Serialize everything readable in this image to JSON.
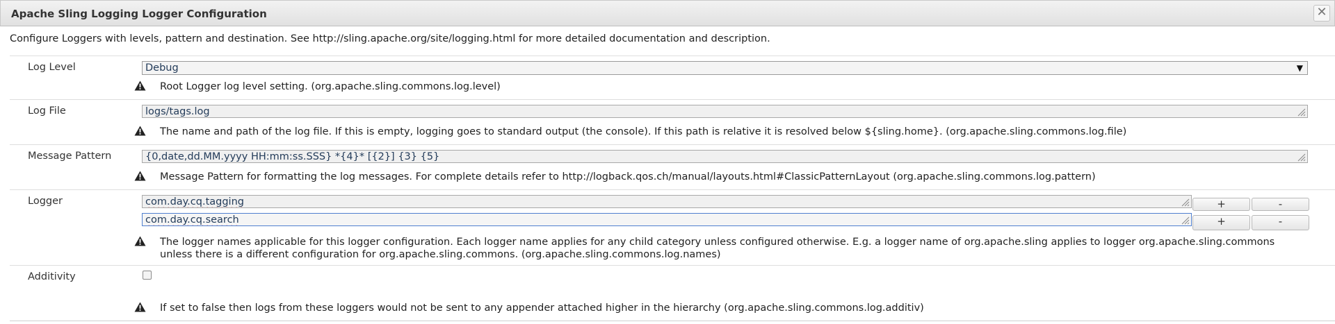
{
  "dialog": {
    "title": "Apache Sling Logging Logger Configuration",
    "close_icon": "close-icon",
    "description": "Configure Loggers with levels, pattern and destination. See http://sling.apache.org/site/logging.html for more detailed documentation and description."
  },
  "fields": {
    "log_level": {
      "label": "Log Level",
      "value": "Debug",
      "hint": "Root Logger log level setting. (org.apache.sling.commons.log.level)"
    },
    "log_file": {
      "label": "Log File",
      "value": "logs/tags.log",
      "hint": "The name and path of the log file. If this is empty, logging goes to standard output (the console). If this path is relative it is resolved below ${sling.home}. (org.apache.sling.commons.log.file)"
    },
    "message_pattern": {
      "label": "Message Pattern",
      "value": "{0,date,dd.MM.yyyy HH:mm:ss.SSS} *{4}* [{2}] {3} {5}",
      "hint": "Message Pattern for formatting the log messages. For complete details refer to http://logback.qos.ch/manual/layouts.html#ClassicPatternLayout (org.apache.sling.commons.log.pattern)"
    },
    "logger": {
      "label": "Logger",
      "values": [
        "com.day.cq.tagging",
        "com.day.cq.search"
      ],
      "add_label": "+",
      "remove_label": "-",
      "hint_line1": "The logger names applicable for this logger configuration. Each logger name applies for any child category unless configured otherwise. E.g. a logger name of org.apache.sling applies to logger org.apache.sling.commons",
      "hint_line2": "unless there is a different configuration for org.apache.sling.commons. (org.apache.sling.commons.log.names)"
    },
    "additivity": {
      "label": "Additivity",
      "checked": false,
      "hint": "If set to false then logs from these loggers would not be sent to any appender attached higher in the hierarchy (org.apache.sling.commons.log.additiv)"
    }
  },
  "icons": {
    "warning": "warning-icon",
    "resize": "resize-grip-icon",
    "dropdown": "chevron-down-icon"
  }
}
